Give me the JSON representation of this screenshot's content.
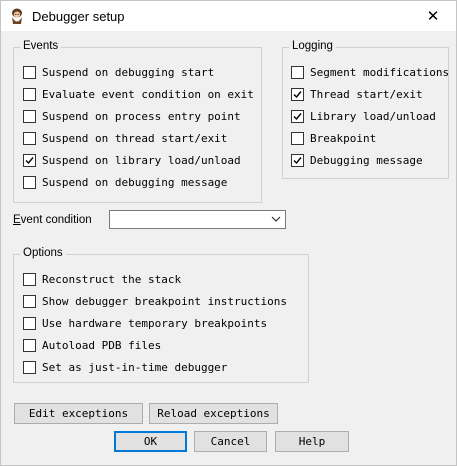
{
  "window": {
    "title": "Debugger setup",
    "close_glyph": "✕"
  },
  "events": {
    "title": "Events",
    "items": [
      {
        "label": "Suspend on debugging start",
        "checked": false
      },
      {
        "label": "Evaluate event condition on exit",
        "checked": false
      },
      {
        "label": "Suspend on process entry point",
        "checked": false
      },
      {
        "label": "Suspend on thread start/exit",
        "checked": false
      },
      {
        "label": "Suspend on library load/unload",
        "checked": true
      },
      {
        "label": "Suspend on debugging message",
        "checked": false
      }
    ]
  },
  "logging": {
    "title": "Logging",
    "items": [
      {
        "label": "Segment modifications",
        "checked": false
      },
      {
        "label": "Thread start/exit",
        "checked": true
      },
      {
        "label": "Library load/unload",
        "checked": true
      },
      {
        "label": "Breakpoint",
        "checked": false
      },
      {
        "label": "Debugging message",
        "checked": true
      }
    ]
  },
  "event_condition": {
    "label_first": "E",
    "label_rest": "vent condition",
    "value": ""
  },
  "options": {
    "title": "Options",
    "items": [
      {
        "label": "Reconstruct the stack",
        "checked": false
      },
      {
        "label": "Show debugger breakpoint instructions",
        "checked": false
      },
      {
        "label": "Use hardware temporary breakpoints",
        "checked": false
      },
      {
        "label": "Autoload PDB files",
        "checked": false
      },
      {
        "label": "Set as just-in-time debugger",
        "checked": false
      }
    ]
  },
  "buttons": {
    "edit_exceptions": "Edit exceptions",
    "reload_exceptions": "Reload exceptions",
    "ok": "OK",
    "cancel": "Cancel",
    "help": "Help"
  },
  "icons": {
    "app": "bug-logo-icon",
    "close": "close-icon",
    "dropdown": "chevron-down-icon",
    "check": "checkmark-icon"
  }
}
